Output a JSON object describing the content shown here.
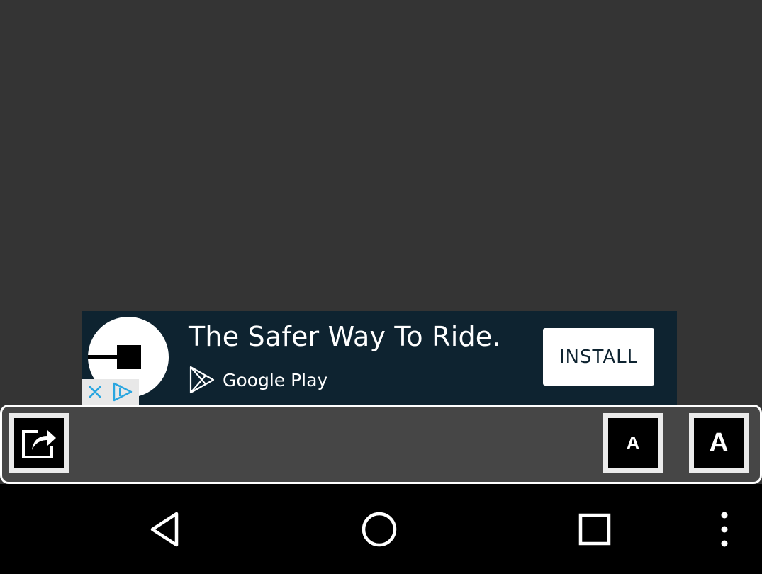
{
  "ad": {
    "title": "The Safer Way To Ride.",
    "store": "Google Play",
    "install_label": "INSTALL",
    "logo_icon": "uber-logo-icon",
    "colors": {
      "background": "#0e2330",
      "button": "#ffffff",
      "adchoices_blue": "#2aa6e0"
    }
  },
  "toolbar": {
    "share_icon": "share-icon",
    "font_small_label": "A",
    "font_large_label": "A"
  },
  "navbar": {
    "icons": [
      "back-icon",
      "home-icon",
      "recents-icon",
      "overflow-menu-icon"
    ]
  }
}
